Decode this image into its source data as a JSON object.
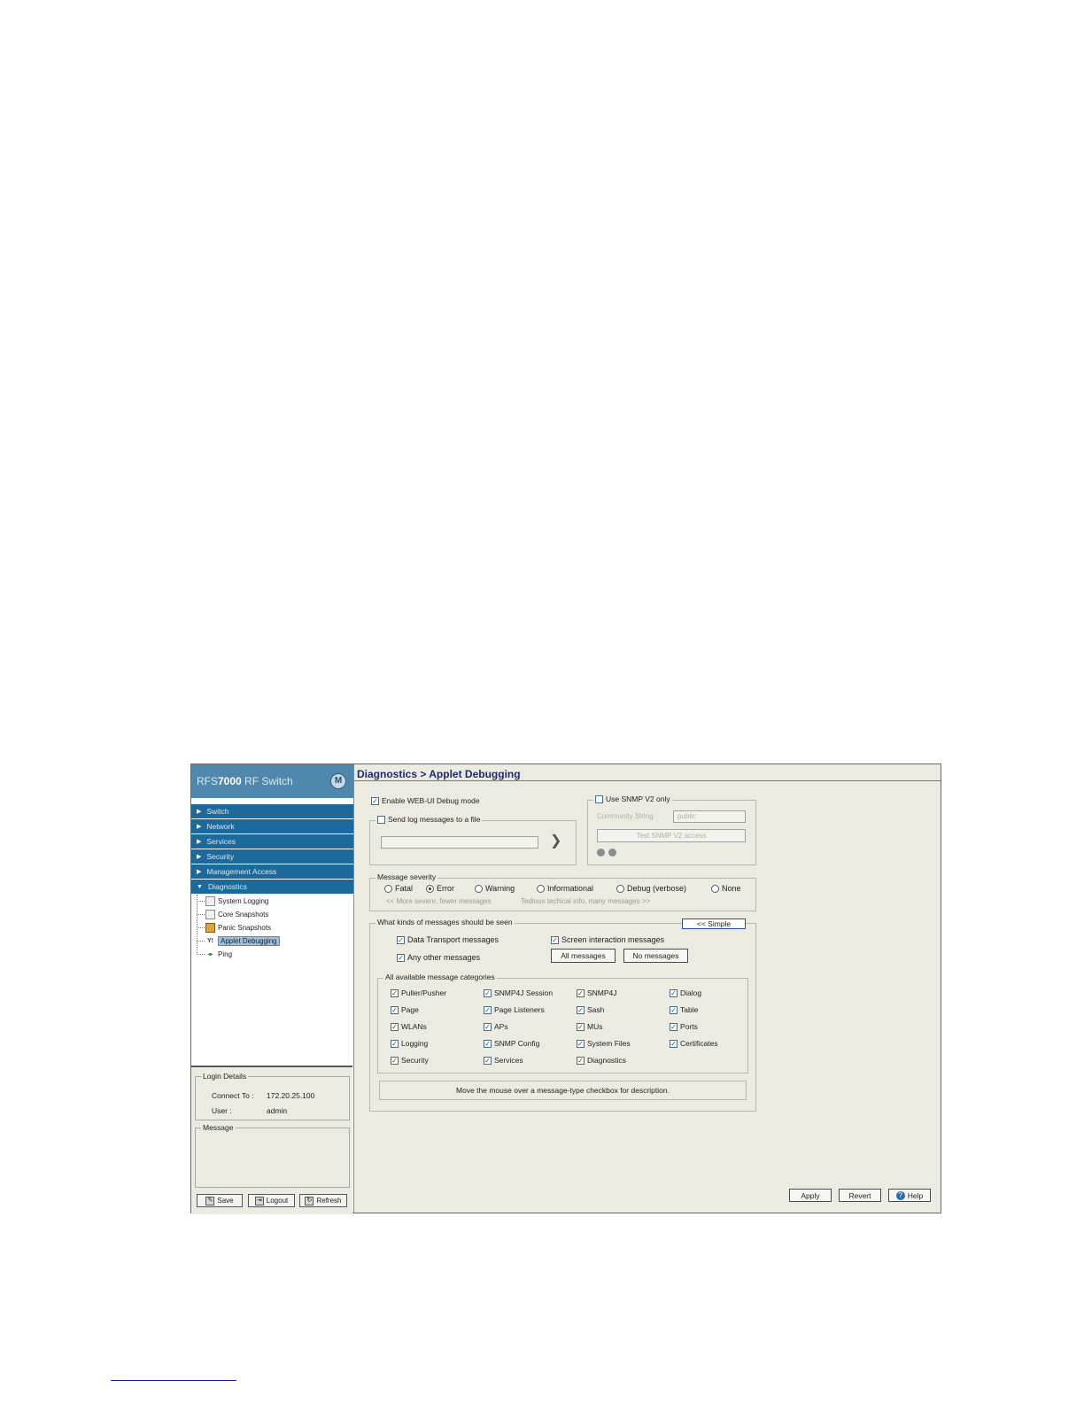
{
  "sidebar": {
    "brand_prefix": "RFS",
    "brand_bold": "7000",
    "brand_suffix": " RF Switch",
    "logo_glyph": "M",
    "nav": [
      {
        "label": "Switch"
      },
      {
        "label": "Network"
      },
      {
        "label": "Services"
      },
      {
        "label": "Security"
      },
      {
        "label": "Management Access"
      },
      {
        "label": "Diagnostics"
      }
    ],
    "tree": [
      {
        "label": "System Logging"
      },
      {
        "label": "Core Snapshots"
      },
      {
        "label": "Panic Snapshots"
      },
      {
        "label": "Applet Debugging"
      },
      {
        "label": "Ping"
      }
    ],
    "login": {
      "legend": "Login Details",
      "connect_label": "Connect To :",
      "connect_value": "172.20.25.100",
      "user_label": "User :",
      "user_value": "admin"
    },
    "message_legend": "Message",
    "buttons": {
      "save": "Save",
      "logout": "Logout",
      "refresh": "Refresh"
    }
  },
  "main": {
    "title": "Diagnostics > Applet Debugging",
    "enable_debug": "Enable WEB-UI Debug mode",
    "send_log": "Send log messages to a file",
    "snmp": {
      "use_v2": "Use SNMP V2 only",
      "community_label": "Community String",
      "community_value": "public",
      "test_button": "Test SNMP V2 access"
    },
    "severity": {
      "legend": "Message severity",
      "options": [
        "Fatal",
        "Error",
        "Warning",
        "Informational",
        "Debug (verbose)",
        "None"
      ],
      "selected": "Error",
      "hint_left": "<< More severe, fewer messages",
      "hint_right": "Tedious techical info, many messages >>"
    },
    "kinds": {
      "legend": "What kinds of messages should be seen",
      "simple_button": "<< Simple",
      "data_transport": "Data Transport messages",
      "screen_interaction": "Screen interaction messages",
      "any_other": "Any other messages",
      "all_button": "All messages",
      "none_button": "No messages"
    },
    "categories": {
      "legend": "All available message categories",
      "items": [
        "Puller/Pusher",
        "SNMP4J Session",
        "SNMP4J",
        "Dialog",
        "Page",
        "Page Listeners",
        "Sash",
        "Table",
        "WLANs",
        "APs",
        "MUs",
        "Ports",
        "Logging",
        "SNMP Config",
        "System Files",
        "Certificates",
        "Security",
        "Services",
        "Diagnostics"
      ]
    },
    "description": "Move the mouse over a message-type checkbox for description.",
    "buttons": {
      "apply": "Apply",
      "revert": "Revert",
      "help": "Help"
    }
  },
  "colors": {
    "brand": "#4f87ad",
    "nav": "#1c6a9c",
    "panel": "#ecebe2",
    "title": "#1e2a6e"
  }
}
